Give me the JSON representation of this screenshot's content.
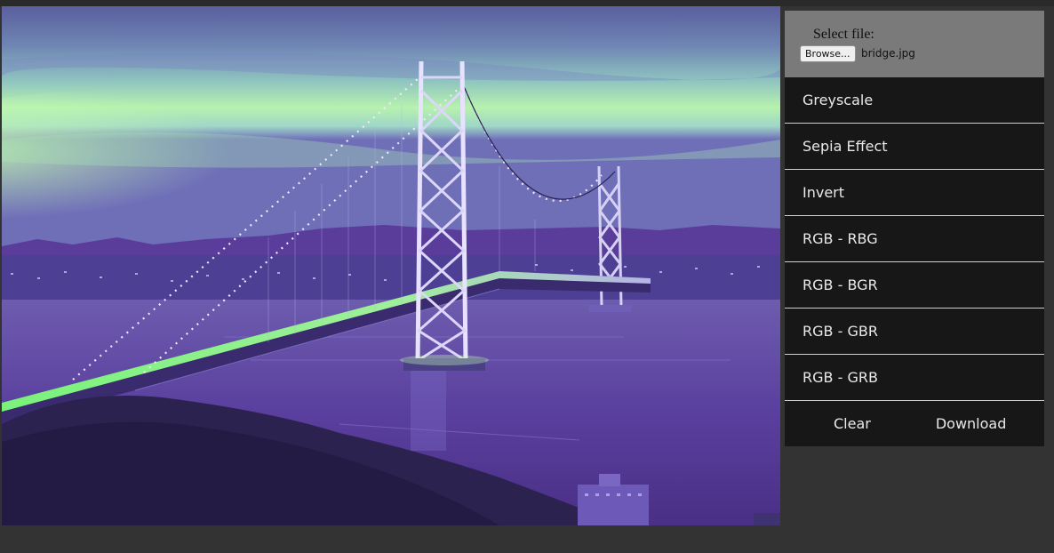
{
  "file_input": {
    "label": "Select file:",
    "browse_label": "Browse...",
    "file_name": "bridge.jpg"
  },
  "filters": [
    {
      "label": "Greyscale"
    },
    {
      "label": "Sepia Effect"
    },
    {
      "label": "Invert"
    },
    {
      "label": "RGB - RBG"
    },
    {
      "label": "RGB - BGR"
    },
    {
      "label": "RGB - GBR"
    },
    {
      "label": "RGB - GRB"
    }
  ],
  "actions": {
    "clear_label": "Clear",
    "download_label": "Download"
  },
  "colors": {
    "page_background": "#333333",
    "panel_background": "#171717",
    "file_box_background": "#7a7a7a",
    "menu_text": "#e8e8e8",
    "divider": "#d0d0d0"
  }
}
